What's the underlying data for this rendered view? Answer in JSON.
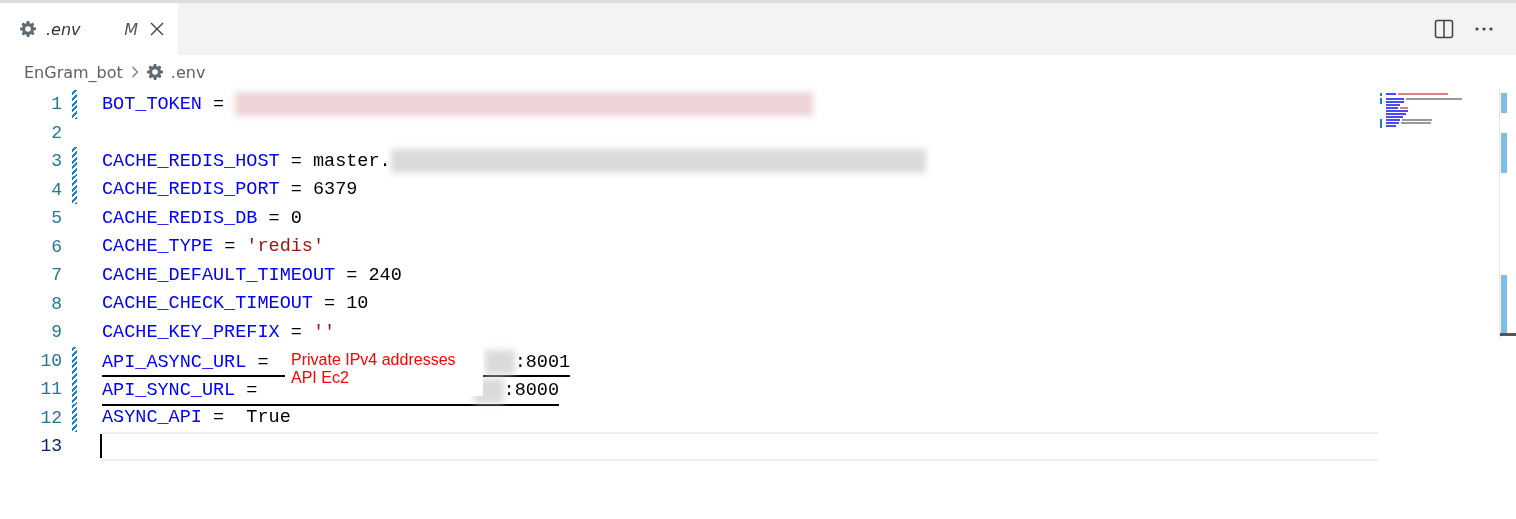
{
  "tabs": [
    {
      "label": ".env",
      "badge": "M",
      "selected": true
    }
  ],
  "breadcrumbs": [
    {
      "label": "EnGram_bot",
      "icon": false
    },
    {
      "label": ".env",
      "icon": true
    }
  ],
  "lines": [
    {
      "number": "1",
      "modified": true,
      "current": false,
      "underlined": false,
      "parts": [
        {
          "kind": "key",
          "text": "BOT_TOKEN"
        },
        {
          "kind": "plain",
          "text": " = "
        },
        {
          "kind": "redacted-string"
        }
      ]
    },
    {
      "number": "2",
      "modified": false,
      "current": false,
      "underlined": false
    },
    {
      "number": "3",
      "modified": true,
      "current": false,
      "underlined": false,
      "parts": [
        {
          "kind": "key",
          "text": "CACHE_REDIS_HOST"
        },
        {
          "kind": "plain",
          "text": " = master."
        },
        {
          "kind": "redacted"
        }
      ]
    },
    {
      "number": "4",
      "modified": true,
      "current": false,
      "underlined": false,
      "parts": [
        {
          "kind": "key",
          "text": "CACHE_REDIS_PORT"
        },
        {
          "kind": "plain",
          "text": " = 6379"
        }
      ]
    },
    {
      "number": "5",
      "modified": false,
      "current": false,
      "underlined": false,
      "parts": [
        {
          "kind": "key",
          "text": "CACHE_REDIS_DB"
        },
        {
          "kind": "plain",
          "text": " = 0"
        }
      ]
    },
    {
      "number": "6",
      "modified": false,
      "current": false,
      "underlined": false,
      "parts": [
        {
          "kind": "key",
          "text": "CACHE_TYPE"
        },
        {
          "kind": "plain",
          "text": " = "
        },
        {
          "kind": "string",
          "text": "'redis'"
        }
      ]
    },
    {
      "number": "7",
      "modified": false,
      "current": false,
      "underlined": false,
      "parts": [
        {
          "kind": "key",
          "text": "CACHE_DEFAULT_TIMEOUT"
        },
        {
          "kind": "plain",
          "text": " = 240"
        }
      ]
    },
    {
      "number": "8",
      "modified": false,
      "current": false,
      "underlined": false,
      "parts": [
        {
          "kind": "key",
          "text": "CACHE_CHECK_TIMEOUT"
        },
        {
          "kind": "plain",
          "text": " = 10"
        }
      ]
    },
    {
      "number": "9",
      "modified": false,
      "current": false,
      "underlined": false,
      "parts": [
        {
          "kind": "key",
          "text": "CACHE_KEY_PREFIX"
        },
        {
          "kind": "plain",
          "text": " = "
        },
        {
          "kind": "string",
          "text": "''"
        }
      ]
    },
    {
      "number": "10",
      "modified": true,
      "current": false,
      "underlined": true,
      "parts": [
        {
          "kind": "key",
          "text": "API_ASYNC_URL"
        },
        {
          "kind": "plain",
          "text": " = "
        },
        {
          "kind": "redacted"
        },
        {
          "kind": "plain",
          "text": ":8001"
        }
      ]
    },
    {
      "number": "11",
      "modified": true,
      "current": false,
      "underlined": true,
      "parts": [
        {
          "kind": "key",
          "text": "API_SYNC_URL"
        },
        {
          "kind": "plain",
          "text": " = "
        },
        {
          "kind": "redacted"
        },
        {
          "kind": "plain",
          "text": ":8000"
        }
      ]
    },
    {
      "number": "12",
      "modified": true,
      "current": false,
      "underlined": false,
      "parts": [
        {
          "kind": "key",
          "text": "ASYNC_API"
        },
        {
          "kind": "plain",
          "text": " =  True"
        }
      ]
    },
    {
      "number": "13",
      "modified": false,
      "current": true,
      "underlined": false
    }
  ],
  "annotation": [
    "Private IPv4 addresses",
    "API Ec2"
  ]
}
